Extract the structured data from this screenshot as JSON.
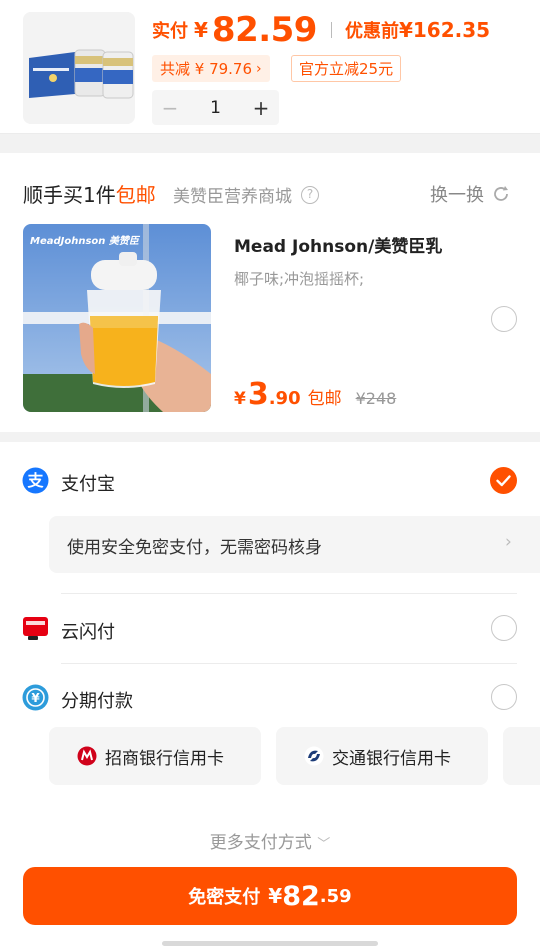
{
  "header": {
    "pay_label": "实付",
    "currency": "¥",
    "pay_amount": "82.59",
    "before_label": "优惠前",
    "before_amount": "¥162.35",
    "save_label": "共减 ¥ 79.76",
    "official_off_label": "官方立减25元",
    "quantity": "1",
    "minus_label": "−",
    "plus_label": "+"
  },
  "addon": {
    "title_prefix": "顺手买1件",
    "title_free": "包邮",
    "shop_name": "美赞臣营养商城",
    "swap_label": "换一换",
    "product_name": "Mead Johnson/美赞臣乳",
    "product_spec": "椰子味;冲泡摇摇杯;",
    "price_yen": "¥",
    "price_int": "3",
    "price_dec": ".90",
    "shipping_label": "包邮",
    "original_price": "¥248",
    "image_brand_text": "MeadJohnson 美赞臣"
  },
  "payment": {
    "methods": [
      {
        "name": "支付宝",
        "selected": true
      },
      {
        "name": "云闪付",
        "selected": false
      },
      {
        "name": "分期付款",
        "selected": false
      }
    ],
    "secure_text": "使用安全免密支付，无需密码核身",
    "banks": [
      {
        "name": "招商银行信用卡"
      },
      {
        "name": "交通银行信用卡"
      }
    ],
    "more_label": "更多支付方式",
    "submit_label": "免密支付",
    "submit_yen": "¥",
    "submit_int": "82",
    "submit_dec": ".59"
  },
  "colors": {
    "accent": "#ff5000",
    "alipay_blue": "#1677ff",
    "unionpay_red": "#e60012",
    "installment_blue": "#2d9cdb"
  }
}
